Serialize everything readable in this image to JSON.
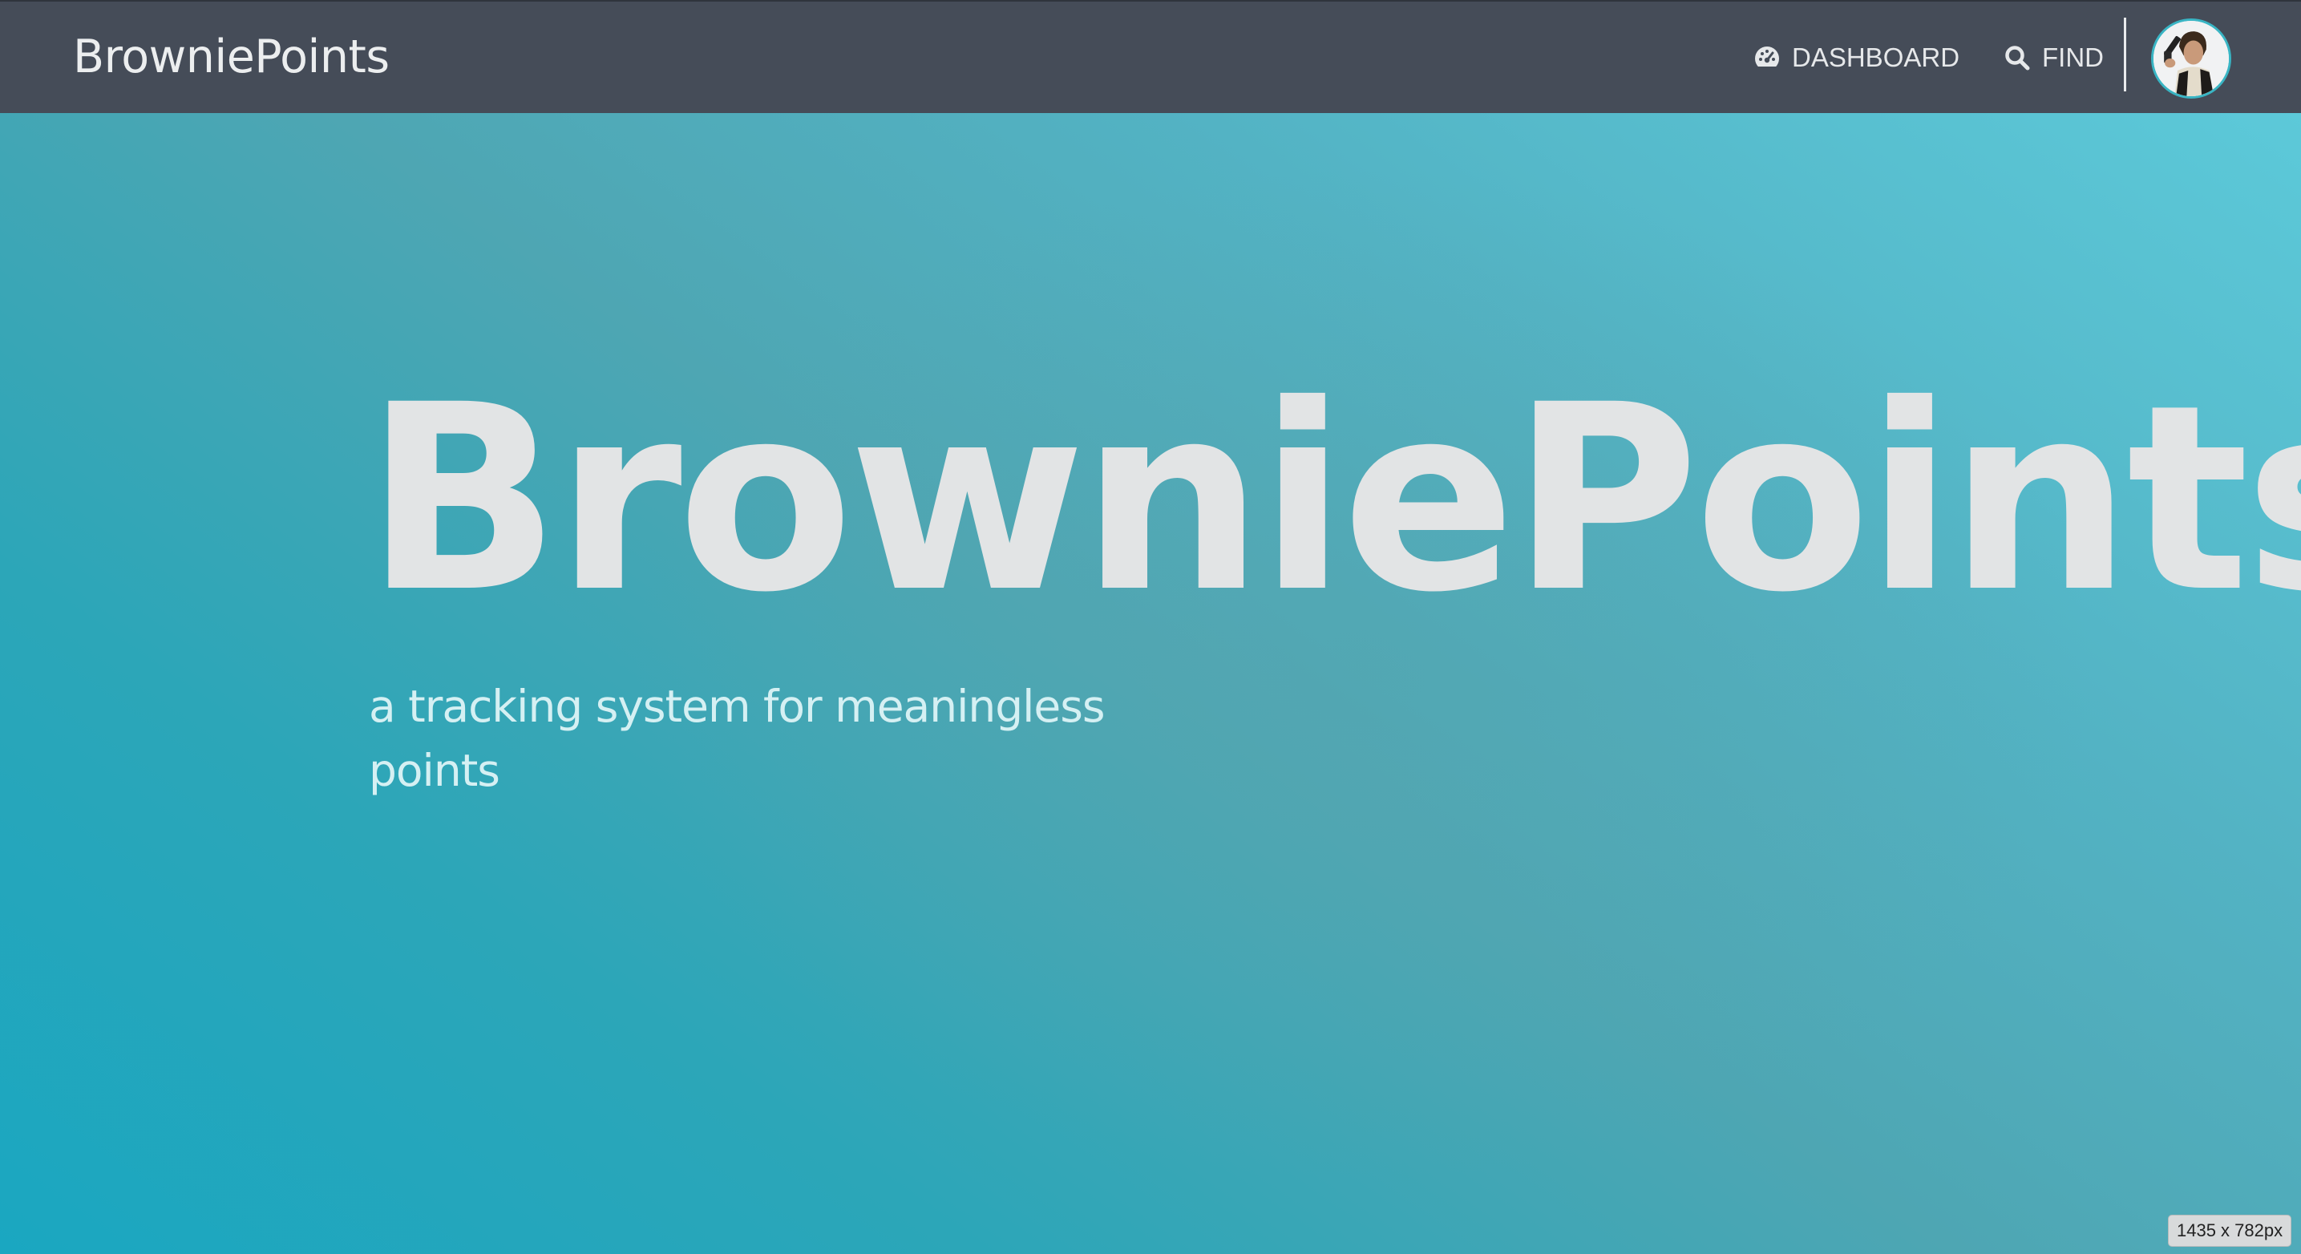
{
  "navbar": {
    "brand": "BrowniePoints",
    "items": [
      {
        "label": "DASHBOARD",
        "icon": "dashboard-gauge-icon"
      },
      {
        "label": "FIND",
        "icon": "search-icon"
      }
    ],
    "avatar_icon": "user-avatar"
  },
  "hero": {
    "title": "BrowniePoints",
    "subtitle": "a tracking system for meaningless points"
  },
  "overlay": {
    "size_badge": "1435 x 782px"
  },
  "colors": {
    "navbar_bg": "#454c58",
    "hero_gradient_start": "#1aa7c1",
    "hero_gradient_end": "#5cc9d9",
    "title_text": "#e2e4e5",
    "subtitle_text": "#d5f0f3"
  }
}
